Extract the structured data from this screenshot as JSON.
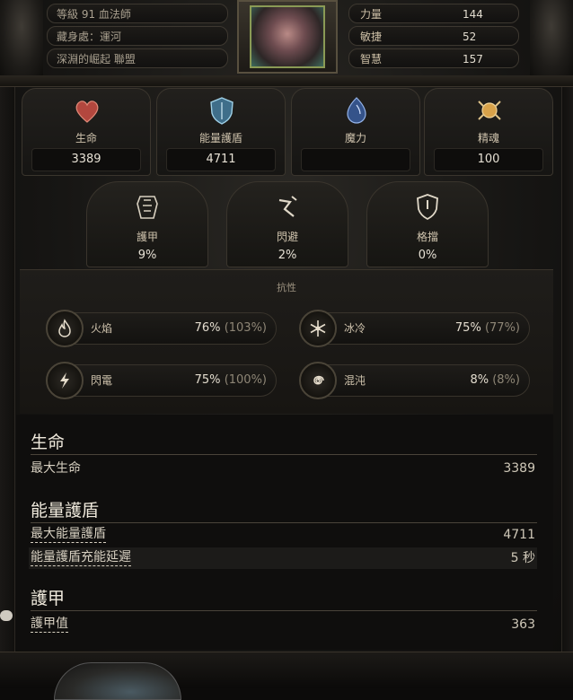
{
  "header": {
    "level_line": "等級 91 血法師",
    "stash_line": "藏身處：運河",
    "league_line": "深淵的崛起 聯盟",
    "attributes": [
      {
        "name": "力量",
        "value": "144"
      },
      {
        "name": "敏捷",
        "value": "52"
      },
      {
        "name": "智慧",
        "value": "157"
      }
    ]
  },
  "top_stats": [
    {
      "label": "生命",
      "value": "3389",
      "icon": "heart-icon"
    },
    {
      "label": "能量護盾",
      "value": "4711",
      "icon": "shield-icon"
    },
    {
      "label": "魔力",
      "value": "",
      "icon": "mana-icon"
    },
    {
      "label": "精魂",
      "value": "100",
      "icon": "spirit-icon"
    }
  ],
  "defenses": [
    {
      "label": "護甲",
      "value": "9%",
      "icon": "armour-icon"
    },
    {
      "label": "閃避",
      "value": "2%",
      "icon": "evasion-icon"
    },
    {
      "label": "格擋",
      "value": "0%",
      "icon": "block-icon"
    }
  ],
  "resistances_title": "抗性",
  "resistances": [
    {
      "name": "火焰",
      "value": "76%",
      "max": "(103%)",
      "icon": "fire-icon"
    },
    {
      "name": "冰冷",
      "value": "75%",
      "max": "(77%)",
      "icon": "cold-icon"
    },
    {
      "name": "閃電",
      "value": "75%",
      "max": "(100%)",
      "icon": "lightning-icon"
    },
    {
      "name": "混沌",
      "value": "8%",
      "max": "(8%)",
      "icon": "chaos-icon"
    }
  ],
  "details": {
    "life": {
      "title": "生命",
      "rows": [
        {
          "label": "最大生命",
          "value": "3389"
        }
      ]
    },
    "es": {
      "title": "能量護盾",
      "rows": [
        {
          "label": "最大能量護盾",
          "value": "4711"
        },
        {
          "label": "能量護盾充能延遲",
          "value": "5 秒"
        }
      ]
    },
    "armour": {
      "title": "護甲",
      "rows": [
        {
          "label": "護甲值",
          "value": "363"
        }
      ]
    }
  },
  "colors": {
    "accent": "#c9bfae",
    "panel": "#171614"
  }
}
